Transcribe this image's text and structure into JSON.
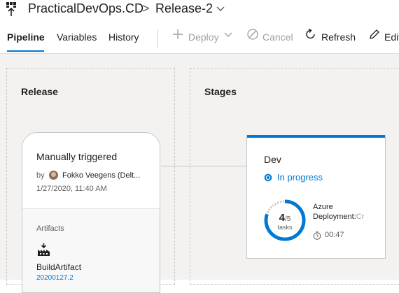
{
  "header": {
    "project": "PracticalDevOps.CD",
    "separator": ">",
    "release": "Release-2"
  },
  "tabs": [
    {
      "label": "Pipeline",
      "active": true
    },
    {
      "label": "Variables",
      "active": false
    },
    {
      "label": "History",
      "active": false
    }
  ],
  "toolbar": {
    "deploy": "Deploy",
    "cancel": "Cancel",
    "refresh": "Refresh",
    "edit": "Edit"
  },
  "lanes": {
    "release_title": "Release",
    "stages_title": "Stages"
  },
  "trigger": {
    "title": "Manually triggered",
    "by_label": "by",
    "user": "Fokko Veegens (Delt...",
    "date": "1/27/2020, 11:40 AM",
    "artifacts_label": "Artifacts",
    "artifact_name": "BuildArtifact",
    "artifact_version": "20200127.2"
  },
  "stage": {
    "name": "Dev",
    "status": "In progress",
    "tasks_done": "4",
    "tasks_total": "/5",
    "tasks_unit": "tasks",
    "progress_fraction": 0.8,
    "job_line1": "Azure",
    "job_line2": "Deployment:",
    "job_line2_fade": "Cr",
    "duration": "00:47"
  },
  "colors": {
    "accent": "#0078d4",
    "canvas": "#f3f2f1",
    "disabled": "#a19f9d"
  }
}
